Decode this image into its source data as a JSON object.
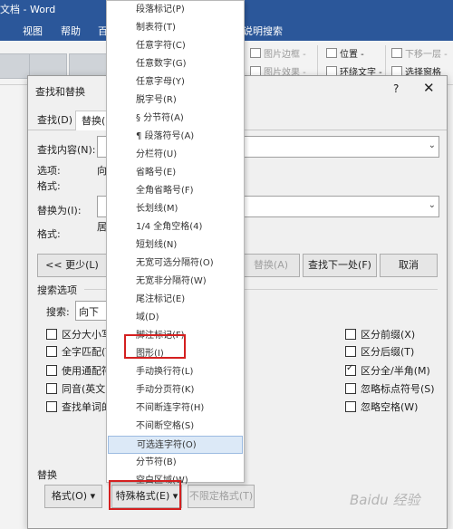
{
  "ribbon": {
    "title": "文档 - Word",
    "tabs": [
      "视图",
      "帮助",
      "百",
      "说明搜索"
    ],
    "items": [
      "图片边框 -",
      "图片效果 -",
      "位置 -",
      "环绕文字 -",
      "下移一层 -",
      "选择窗格"
    ]
  },
  "dialog": {
    "title": "查找和替换",
    "help": "?",
    "close": "✕",
    "tabs": [
      "查找(D)",
      "替换(P"
    ],
    "find_label": "查找内容(N):",
    "options_label": "选项:",
    "options_value": "向下",
    "format_label": "格式:",
    "replace_label": "替换为(I):",
    "format_label2": "格式:",
    "format_value2": "居中",
    "less_button": "<< 更少(L)",
    "replace_button": "替换(A)",
    "find_next_button": "查找下一处(F)",
    "cancel_button": "取消",
    "search_options_title": "搜索选项",
    "search_label": "搜索:",
    "search_value": "向下",
    "left_checks": [
      {
        "label": "区分大小写",
        "checked": false
      },
      {
        "label": "全字匹配(Y)",
        "checked": false
      },
      {
        "label": "使用通配符",
        "checked": false
      },
      {
        "label": "同音(英文)(",
        "checked": false
      },
      {
        "label": "查找单词的所",
        "checked": false
      }
    ],
    "right_checks": [
      {
        "label": "区分前缀(X)",
        "checked": false
      },
      {
        "label": "区分后缀(T)",
        "checked": false
      },
      {
        "label": "区分全/半角(M)",
        "checked": true
      },
      {
        "label": "忽略标点符号(S)",
        "checked": false
      },
      {
        "label": "忽略空格(W)",
        "checked": false
      }
    ],
    "replace_section_title": "替换",
    "format_button": "格式(O) ▾",
    "special_button": "特殊格式(E) ▾",
    "no_format_button": "不限定格式(T)"
  },
  "menu": {
    "items": [
      "段落标记(P)",
      "制表符(T)",
      "任意字符(C)",
      "任意数字(G)",
      "任意字母(Y)",
      "脱字号(R)",
      "§ 分节符(A)",
      "¶ 段落符号(A)",
      "分栏符(U)",
      "省略号(E)",
      "全角省略号(F)",
      "长划线(M)",
      "1/4 全角空格(4)",
      "短划线(N)",
      "无宽可选分隔符(O)",
      "无宽非分隔符(W)",
      "尾注标记(E)",
      "域(D)",
      "脚注标记(F)",
      "图形(I)",
      "手动换行符(L)",
      "手动分页符(K)",
      "不间断连字符(H)",
      "不间断空格(S)",
      "可选连字符(O)",
      "分节符(B)",
      "空白区域(W)"
    ],
    "selected_index": 24,
    "highlighted_index": 19
  },
  "watermark": "Baidu 经验"
}
